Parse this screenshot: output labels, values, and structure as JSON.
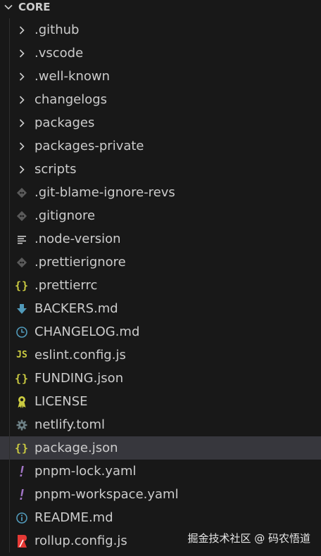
{
  "explorer": {
    "section_title": "CORE"
  },
  "colors": {
    "background": "#181818",
    "selected_row": "#37373d",
    "git_icon": "#5a5a5a",
    "json_icon": "#cbcb41",
    "js_icon": "#cbcb41",
    "markdown_icon": "#519aba",
    "yaml_icon": "#a074c4",
    "license_icon": "#cbcb41",
    "settings_icon": "#6d8086",
    "rollup_icon": "#e53935"
  },
  "items": [
    {
      "label": ".github",
      "kind": "folder",
      "icon": "chevron-right-icon"
    },
    {
      "label": ".vscode",
      "kind": "folder",
      "icon": "chevron-right-icon"
    },
    {
      "label": ".well-known",
      "kind": "folder",
      "icon": "chevron-right-icon"
    },
    {
      "label": "changelogs",
      "kind": "folder",
      "icon": "chevron-right-icon"
    },
    {
      "label": "packages",
      "kind": "folder",
      "icon": "chevron-right-icon"
    },
    {
      "label": "packages-private",
      "kind": "folder",
      "icon": "chevron-right-icon"
    },
    {
      "label": "scripts",
      "kind": "folder",
      "icon": "chevron-right-icon"
    },
    {
      "label": ".git-blame-ignore-revs",
      "kind": "file",
      "icon": "git-file-icon"
    },
    {
      "label": ".gitignore",
      "kind": "file",
      "icon": "git-file-icon"
    },
    {
      "label": ".node-version",
      "kind": "file",
      "icon": "text-lines-icon"
    },
    {
      "label": ".prettierignore",
      "kind": "file",
      "icon": "git-file-icon"
    },
    {
      "label": ".prettierrc",
      "kind": "file",
      "icon": "json-braces-icon"
    },
    {
      "label": "BACKERS.md",
      "kind": "file",
      "icon": "download-arrow-icon"
    },
    {
      "label": "CHANGELOG.md",
      "kind": "file",
      "icon": "clock-icon"
    },
    {
      "label": "eslint.config.js",
      "kind": "file",
      "icon": "js-icon"
    },
    {
      "label": "FUNDING.json",
      "kind": "file",
      "icon": "json-braces-icon"
    },
    {
      "label": "LICENSE",
      "kind": "file",
      "icon": "license-ribbon-icon"
    },
    {
      "label": "netlify.toml",
      "kind": "file",
      "icon": "gear-icon"
    },
    {
      "label": "package.json",
      "kind": "file",
      "icon": "json-braces-icon",
      "selected": true
    },
    {
      "label": "pnpm-lock.yaml",
      "kind": "file",
      "icon": "yaml-exclamation-icon"
    },
    {
      "label": "pnpm-workspace.yaml",
      "kind": "file",
      "icon": "yaml-exclamation-icon"
    },
    {
      "label": "README.md",
      "kind": "file",
      "icon": "info-circle-icon"
    },
    {
      "label": "rollup.config.js",
      "kind": "file",
      "icon": "rollup-icon"
    }
  ],
  "watermark": "掘金技术社区 @ 码农悟道"
}
